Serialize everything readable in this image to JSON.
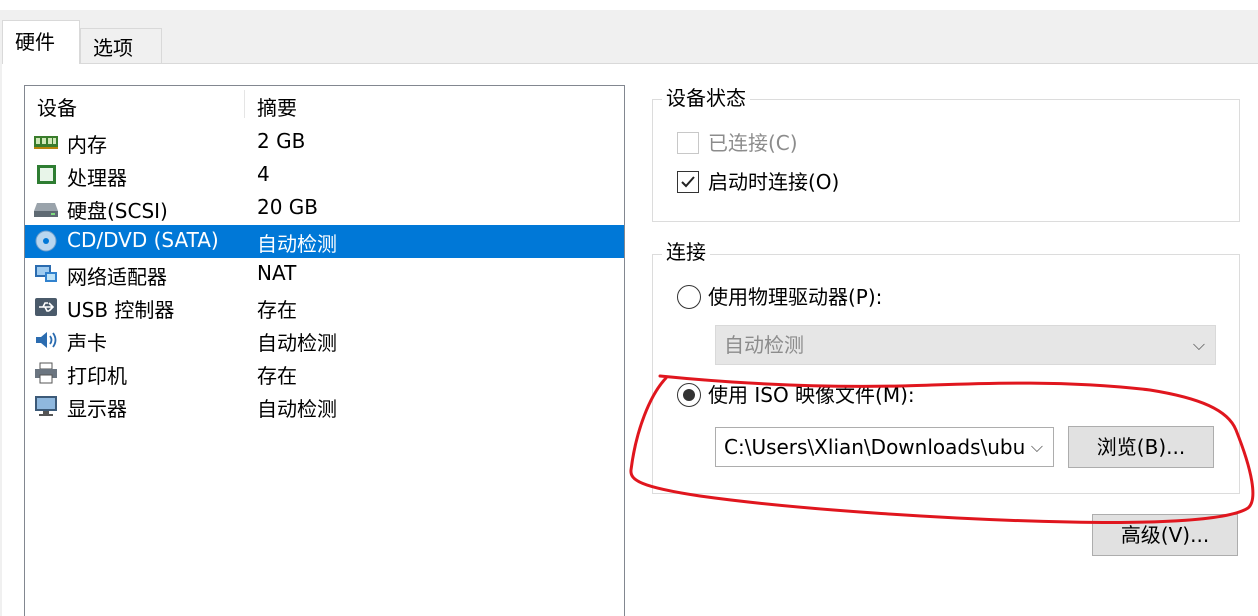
{
  "tabs": [
    {
      "label": "硬件",
      "active": true
    },
    {
      "label": "选项",
      "active": false
    }
  ],
  "device_list": {
    "columns": [
      "设备",
      "摘要"
    ],
    "rows": [
      {
        "name": "内存",
        "summary": "2 GB",
        "icon": "memory-icon"
      },
      {
        "name": "处理器",
        "summary": "4",
        "icon": "cpu-icon"
      },
      {
        "name": "硬盘(SCSI)",
        "summary": "20 GB",
        "icon": "harddisk-icon"
      },
      {
        "name": "CD/DVD (SATA)",
        "summary": "自动检测",
        "icon": "cd-dvd-icon",
        "selected": true
      },
      {
        "name": "网络适配器",
        "summary": "NAT",
        "icon": "network-adapter-icon"
      },
      {
        "name": "USB 控制器",
        "summary": "存在",
        "icon": "usb-icon"
      },
      {
        "name": "声卡",
        "summary": "自动检测",
        "icon": "sound-card-icon"
      },
      {
        "name": "打印机",
        "summary": "存在",
        "icon": "printer-icon"
      },
      {
        "name": "显示器",
        "summary": "自动检测",
        "icon": "monitor-icon"
      }
    ]
  },
  "device_status": {
    "title": "设备状态",
    "connected_label": "已连接(C)",
    "connected_checked": false,
    "connected_disabled": true,
    "connect_at_power_on_label": "启动时连接(O)",
    "connect_at_power_on_checked": true
  },
  "connection": {
    "title": "连接",
    "physical_drive_label": "使用物理驱动器(P):",
    "physical_drive_selected": false,
    "physical_drive_value": "自动检测",
    "iso_label": "使用 ISO 映像文件(M):",
    "iso_selected": true,
    "iso_path": "C:\\Users\\Xlian\\Downloads\\ubu",
    "browse_label": "浏览(B)..."
  },
  "advanced_label": "高级(V)...",
  "annotation_color": "#e0161e"
}
